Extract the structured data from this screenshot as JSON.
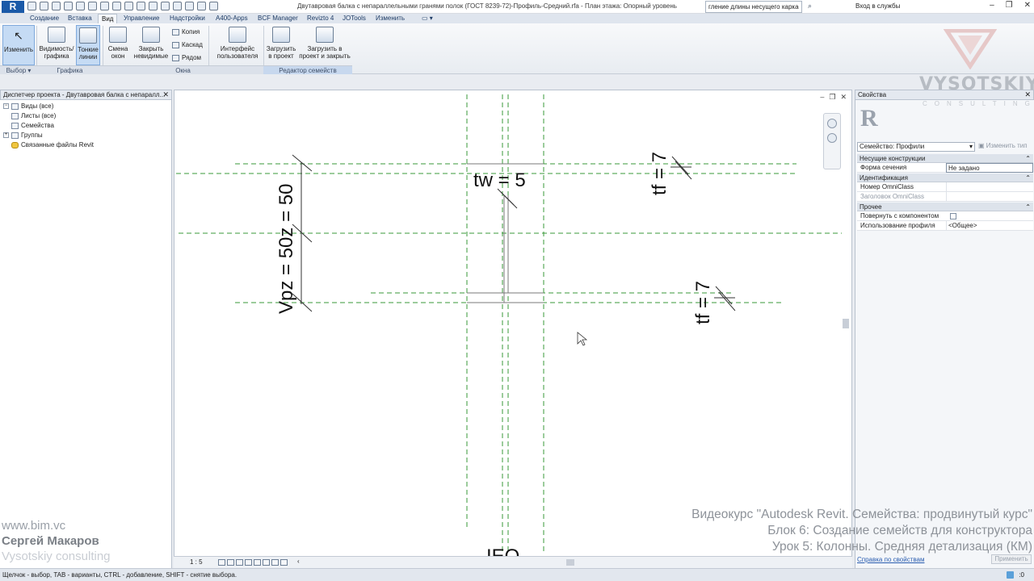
{
  "app": {
    "logo_letter": "R",
    "title": "Двутавровая балка с непараллельными гранями полок (ГОСТ 8239-72)-Профиль-Средний.rfa - План этажа: Опорный уровень",
    "search_value": "гление длины несущего каркаса",
    "login": "Вход в службы",
    "window_controls": [
      "–",
      "❐",
      "✕"
    ]
  },
  "tabs": [
    "Создание",
    "Вставка",
    "Вид",
    "Управление",
    "Надстройки",
    "A400-Apps",
    "BCF Manager",
    "Revizto 4",
    "JOTools",
    "Изменить"
  ],
  "active_tab": "Вид",
  "ribbon": {
    "modify": "Изменить",
    "visibility": "Видимость/ графика",
    "thin_lines": "Тонкие линии",
    "switch_windows": "Смена окон",
    "close_hidden": "Закрыть невидимые",
    "copy": "Копия",
    "cascade": "Каскад",
    "tile": "Рядом",
    "user_interface": "Интерфейс пользователя",
    "load_into_project": "Загрузить в проект",
    "load_and_close": "Загрузить в проект и закрыть",
    "groups": {
      "select": "Выбор ▾",
      "graphics": "Графика",
      "windows": "Окна",
      "family_editor": "Редактор семейств"
    }
  },
  "browser": {
    "title": "Диспетчер проекта - Двутавровая балка с непаралл...",
    "items": [
      {
        "label": "Виды (все)",
        "toggle": "−"
      },
      {
        "label": "Листы (все)",
        "toggle": ""
      },
      {
        "label": "Семейства",
        "toggle": ""
      },
      {
        "label": "Группы",
        "toggle": "+"
      },
      {
        "label": "Связанные файлы Revit",
        "toggle": ""
      }
    ]
  },
  "credits": {
    "site": "www.bim.vc",
    "author": "Сергей Макаров",
    "company": "Vysotskiy consulting"
  },
  "canvas": {
    "labels": {
      "tw": "tw = 5",
      "tf_top": "tf = 7",
      "tf_bottom": "tf = 7",
      "vpz": "Vpz = 50z = 50",
      "partial": "IEQ"
    },
    "scale": "1 : 5",
    "reference_line_color": "#3a9a3a"
  },
  "properties": {
    "title": "Свойства",
    "type_image_letter": "R",
    "family_selector": "Семейство: Профили",
    "edit_type": "Изменить тип",
    "categories": [
      {
        "name": "Несущие конструкции",
        "rows": [
          {
            "name": "Форма сечения",
            "value": "Не задано"
          }
        ]
      },
      {
        "name": "Идентификация",
        "rows": [
          {
            "name": "Номер OmniClass",
            "value": ""
          },
          {
            "name": "Заголовок OmniClass",
            "value": ""
          }
        ]
      },
      {
        "name": "Прочее",
        "rows": [
          {
            "name": "Повернуть с компонентом",
            "value": ""
          },
          {
            "name": "Использование профиля",
            "value": "<Общее>"
          }
        ]
      }
    ],
    "help_link": "Справка по свойствам",
    "apply": "Применить"
  },
  "watermark": {
    "name": "VYSOTSKIY",
    "sub": "CONSULTING"
  },
  "course": {
    "line1": "Видеокурс \"Autodesk Revit. Семейства: продвинутый курс\"",
    "line2": "Блок 6: Создание семейств для конструктора",
    "line3": "Урок 5: Колонны. Средняя детализация (КМ)"
  },
  "status": {
    "text": "Щелчок - выбор, TAB - варианты, CTRL - добавление, SHIFT - снятие выбора.",
    "selected_count": ":0"
  }
}
